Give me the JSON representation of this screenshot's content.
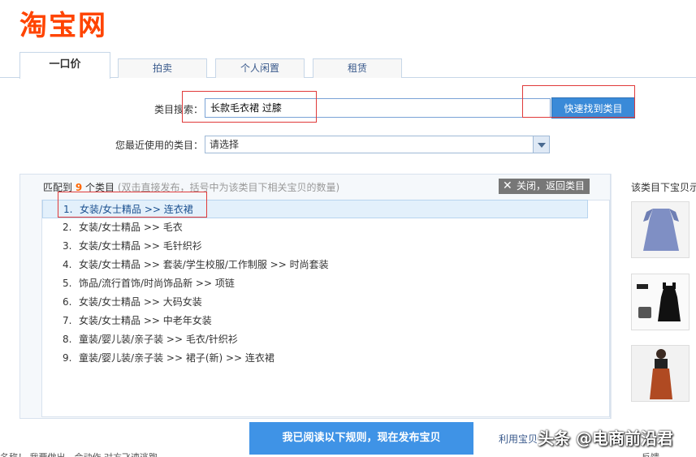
{
  "logo": "淘宝网",
  "tabs": [
    {
      "label": "一口价"
    },
    {
      "label": "拍卖"
    },
    {
      "label": "个人闲置"
    },
    {
      "label": "租赁"
    }
  ],
  "category_search": {
    "label": "类目搜索：",
    "value": "长款毛衣裙 过膝",
    "button": "快速找到类目"
  },
  "recent": {
    "label": "您最近使用的类目：",
    "selected": "请选择"
  },
  "matches": {
    "prefix": "匹配到",
    "count": "9",
    "suffix": "个类目",
    "hint": "(双击直接发布，括号中为该类目下相关宝贝的数量)",
    "close_label": "关闭，返回类目",
    "items": [
      {
        "num": "1.",
        "text": "女装/女士精品 >> 连衣裙"
      },
      {
        "num": "2.",
        "text": "女装/女士精品 >> 毛衣"
      },
      {
        "num": "3.",
        "text": "女装/女士精品 >> 毛针织衫"
      },
      {
        "num": "4.",
        "text": "女装/女士精品 >> 套装/学生校服/工作制服 >> 时尚套装"
      },
      {
        "num": "5.",
        "text": "饰品/流行首饰/时尚饰品新 >> 项链"
      },
      {
        "num": "6.",
        "text": "女装/女士精品 >> 大码女装"
      },
      {
        "num": "7.",
        "text": "女装/女士精品 >> 中老年女装"
      },
      {
        "num": "8.",
        "text": "童装/婴儿装/亲子装 >> 毛衣/针织衫"
      },
      {
        "num": "9.",
        "text": "童装/婴儿装/亲子装 >> 裙子(新) >> 连衣裙"
      }
    ]
  },
  "side": {
    "title": "该类目下宝贝示"
  },
  "publish_button": "我已阅读以下规则，现在发布宝贝",
  "bottom_link": "利用宝贝",
  "watermark": "头条 @电商前沿君",
  "footer_left": "名称！ 我要做出…会动作 对方飞速逃跑",
  "footer_right": "反馈"
}
